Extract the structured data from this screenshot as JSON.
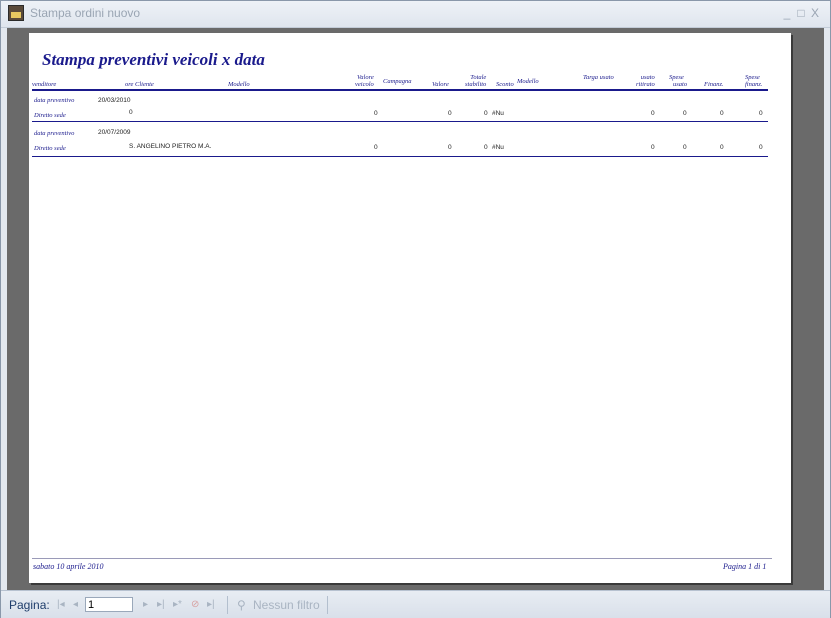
{
  "window": {
    "title": "Stampa ordini nuovo",
    "controls": [
      "_",
      "□",
      "X"
    ]
  },
  "report": {
    "title": "Stampa preventivi veicoli x data",
    "headers": {
      "venditore": "venditore",
      "ore": "ore",
      "cliente": "Cliente",
      "modello": "Modello",
      "valore_veicolo": [
        "Valore",
        "veicolo"
      ],
      "campagna": "Campagna",
      "valore": "Valore",
      "totale_stabilito": [
        "Totale",
        "stabilito"
      ],
      "sconto": "Sconto",
      "modello2": "Modello",
      "targa_usato": "Targa usato",
      "usato_ritirato": [
        "usato",
        "ritirato"
      ],
      "spese_usato": [
        "Spese",
        "usato"
      ],
      "finanz": "Finanz.",
      "spese_finanz": [
        "Spese",
        "finanz."
      ]
    },
    "groups": [
      {
        "data_label": "data preventivo",
        "data_value": "20/03/2010",
        "row_label": "Diretto sede",
        "cliente": "0",
        "valore_veicolo": "0",
        "valore": "0",
        "totale": "0",
        "sconto": "#Nu",
        "usato_ritirato": "0",
        "spese_usato": "0",
        "finanz": "0",
        "spese_finanz": "0"
      },
      {
        "data_label": "data preventivo",
        "data_value": "20/07/2009",
        "row_label": "Diretto sede",
        "cliente": "S. ANGELINO PIETRO M.A.",
        "valore_veicolo": "0",
        "valore": "0",
        "totale": "0",
        "sconto": "#Nu",
        "usato_ritirato": "0",
        "spese_usato": "0",
        "finanz": "0",
        "spese_finanz": "0"
      }
    ],
    "footer": {
      "date": "sabato 10 aprile 2010",
      "page": "Pagina 1 di 1"
    }
  },
  "navbar": {
    "label": "Pagina:",
    "first": "|◂",
    "prev": "◂",
    "page_value": "1",
    "next": "▸",
    "last": "▸|",
    "new": "▸*",
    "stop": "⊘",
    "stop2": "▸|",
    "filter_icon": "⚲",
    "filter_label": "Nessun filtro"
  }
}
